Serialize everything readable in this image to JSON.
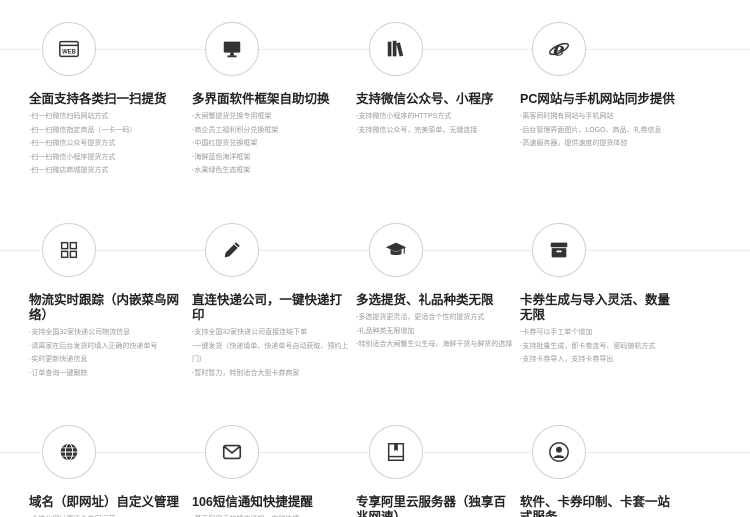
{
  "rows": [
    {
      "cards": [
        {
          "icon": "web-icon",
          "title": "全面支持各类扫一扫提货",
          "items": [
            "-扫一扫微信扫码网站方式",
            "-扫一扫微信指定商品（一卡一码）",
            "-扫一扫微信公众号提货方式",
            "-扫一扫微信小程序提货方式",
            "-扫一扫微店商城提货方式"
          ]
        },
        {
          "icon": "monitor-icon",
          "title": "多界面软件框架自助切换",
          "items": [
            "-大闸蟹提货兑换专用框架",
            "-商企员工福利积分兑换框架",
            "-中国红提货兑换框架",
            "-海鲜蓝色海洋框架",
            "-水果绿色生态框架"
          ]
        },
        {
          "icon": "books-icon",
          "title": "支持微信公众号、小程序",
          "items": [
            "-支持微信小程序的HTTPS方式",
            "-支持微信公众号，完美菜单，无缝连接"
          ]
        },
        {
          "icon": "ie-icon",
          "title": "PC网站与手机网站同步提供",
          "items": [
            "-离客同时拥有网站与手机网站",
            "-后台管理界面图片、LOGO、商品、礼券信息",
            "-高速服务器，提供速度的提货体验"
          ]
        }
      ]
    },
    {
      "cards": [
        {
          "icon": "grid-icon",
          "title": "物流实时跟踪（内嵌菜鸟网络）",
          "items": [
            "-支持全国32家快递公司物流信息",
            "-请离家在后台发货时填入正确的快递单号",
            "-实时更新快递信息",
            "-订单查询一键跟踪"
          ]
        },
        {
          "icon": "pencil-icon",
          "title": "直连快递公司，一键快递打印",
          "items": [
            "-支持全国32家快递公司直接连结下单",
            "-一键发货（快递填单、快递单号自动获取、预约上门）",
            "-暂时暂力，特别适合大型卡券商家"
          ]
        },
        {
          "icon": "graduation-cap-icon",
          "title": "多选提货、礼品种类无限",
          "items": [
            "-多选提货更灵活，更适合个性的提货方式",
            "-礼品种类无限增加",
            "-特别适合大闸蟹生公生母、海鲜干货与鲜货的选择"
          ]
        },
        {
          "icon": "archive-icon",
          "title": "卡券生成与导入灵活、数量无限",
          "items": [
            "-卡券可以手工单个增加",
            "-支持批量生成，即卡卷连号、密码随机方式",
            "-支持卡券导入，支持卡券导出"
          ]
        }
      ]
    },
    {
      "cards": [
        {
          "icon": "globe-icon",
          "title": "域名（即网址）自定义管理",
          "items": [
            "-个性化网址更适合商家运营"
          ]
        },
        {
          "icon": "envelope-icon",
          "title": "106短信通知快捷提醒",
          "items": [
            "-基于阿里云的短信通知，实时快捷"
          ]
        },
        {
          "icon": "book-icon",
          "title": "专享阿里云服务器（独享百兆网速）",
          "items": []
        },
        {
          "icon": "user-circle-icon",
          "title": "软件、卡券印制、卡套一站式服务",
          "items": []
        }
      ]
    }
  ]
}
